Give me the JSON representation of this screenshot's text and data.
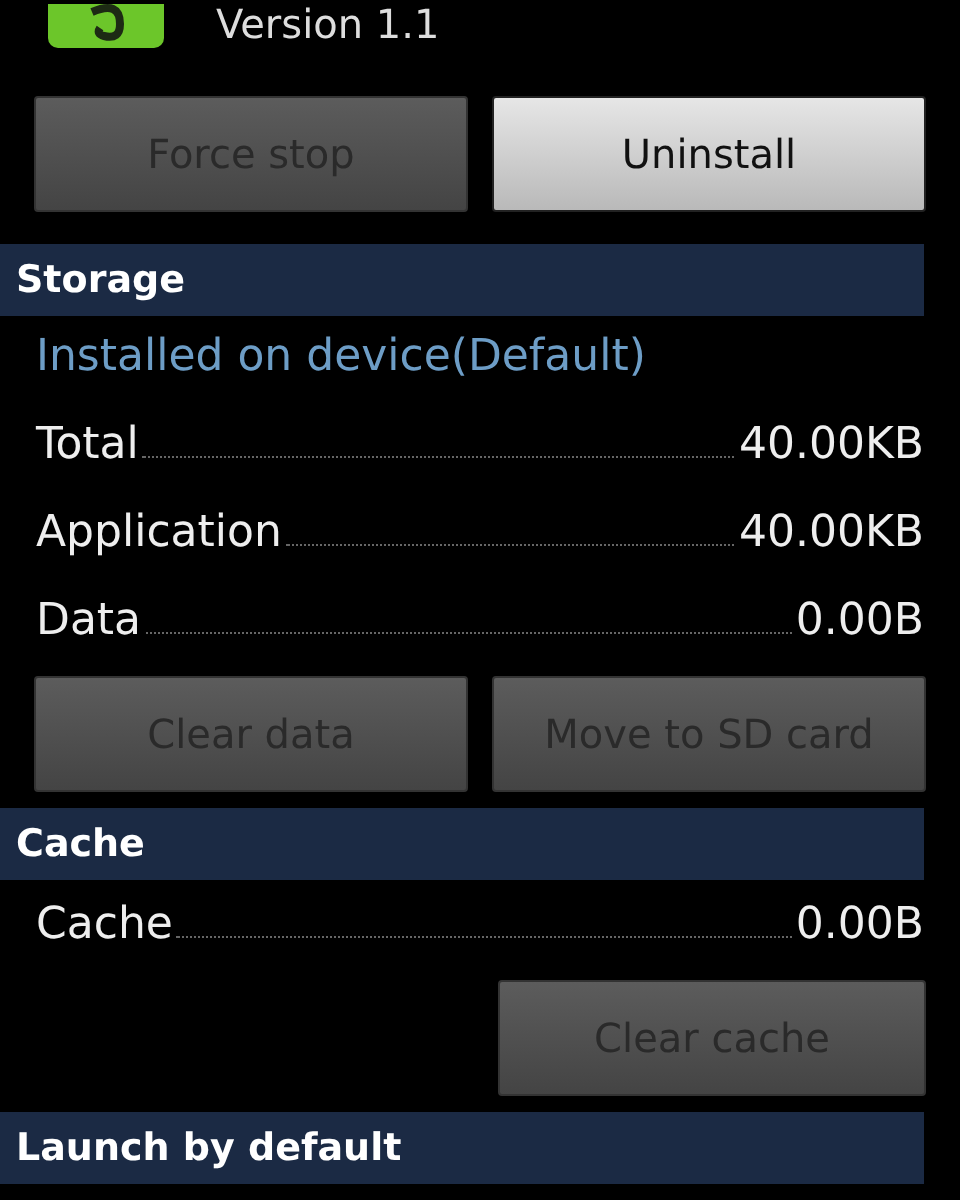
{
  "app": {
    "version": "Version 1.1"
  },
  "actions": [
    {
      "label": "Force stop",
      "disabled": true
    },
    {
      "label": "Uninstall",
      "disabled": false
    }
  ],
  "sections": [
    {
      "title": "Storage",
      "subtitle": "Installed on device(Default)",
      "rows": [
        {
          "label": "Total",
          "value": "40.00KB"
        },
        {
          "label": "Application",
          "value": "40.00KB"
        },
        {
          "label": "Data",
          "value": "0.00B"
        }
      ],
      "buttons": [
        {
          "label": "Clear data",
          "disabled": true
        },
        {
          "label": "Move to SD card",
          "disabled": true
        }
      ]
    },
    {
      "title": "Cache",
      "rows": [
        {
          "label": "Cache",
          "value": "0.00B"
        }
      ],
      "buttons": [
        {
          "label": "Clear cache",
          "disabled": true
        }
      ]
    },
    {
      "title": "Launch by default"
    }
  ]
}
